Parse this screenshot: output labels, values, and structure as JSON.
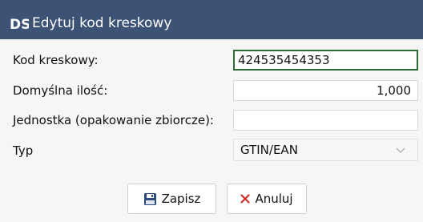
{
  "window": {
    "title": "Edytuj kod kreskowy",
    "logo_text": "DS"
  },
  "form": {
    "barcode_label": "Kod kreskowy:",
    "barcode_value": "424535454353",
    "default_qty_label": "Domyślna ilość:",
    "default_qty_value": "1,000",
    "unit_label": "Jednostka (opakowanie zbiorcze):",
    "unit_value": "",
    "type_label": "Typ",
    "type_value": "GTIN/EAN"
  },
  "buttons": {
    "save_label": "Zapisz",
    "cancel_label": "Anuluj"
  },
  "colors": {
    "titlebar": "#3c5376",
    "focus_border": "#2e6a36",
    "cancel_icon": "#d32f2f",
    "save_icon": "#2c4a7a"
  }
}
